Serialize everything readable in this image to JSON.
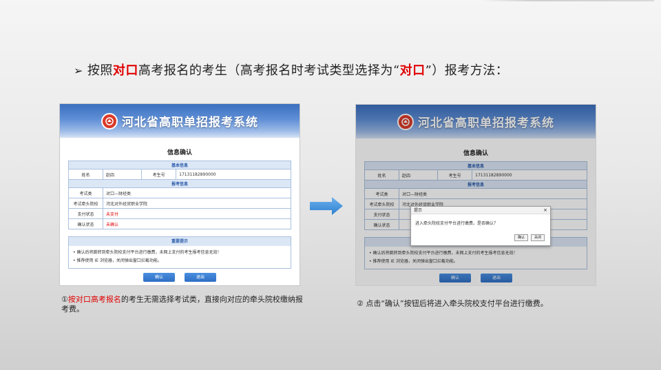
{
  "heading": {
    "bullet": "➢",
    "prefix": "按照",
    "highlight": "对口",
    "middle": "高考报名的考生（高考报名时考试类型选择为“",
    "highlight2": "对口",
    "suffix": "”）报考方法："
  },
  "system_title": "河北省高职单招报考系统",
  "left_panel": {
    "form_title": "信息确认",
    "basic_section": "基本信息",
    "name_label": "姓名",
    "name_value": "赵四",
    "exam_no_label": "考生号",
    "exam_no_value": "17131182890000",
    "apply_section": "报考信息",
    "exam_type_label": "考试类",
    "exam_type_value": "对口—财经类",
    "school_label": "考试牵头院校",
    "school_value": "河北对外经贸职业学院",
    "pay_label": "支付状态",
    "pay_value": "未支付",
    "confirm_label": "确认状态",
    "confirm_value": "未确认",
    "tips_title": "重要提示",
    "tip1": "确认后将跳转到牵头院校支付平台进行缴费，未网上支付的考生报考信息无效！",
    "tip2": "推荐使用 IE 浏览器，关闭弹出窗口拦截功能。",
    "confirm_button": "确认",
    "exit_button": "退出"
  },
  "right_panel": {
    "form_title": "信息确认",
    "basic_section": "基本信息",
    "name_label": "姓名",
    "name_value": "赵四",
    "exam_no_label": "考生号",
    "exam_no_value": "17131182890000",
    "apply_section": "报考信息",
    "exam_type_label": "考试类",
    "exam_type_value": "对口—财经类",
    "school_label": "考试牵头院校",
    "school_value": "河北对外经贸职业学院",
    "pay_label": "支付状态",
    "confirm_label": "确认状态",
    "tip1": "确认后将跳转到牵头院校支付平台进行缴费，未网上支付的考生报考信息无效！",
    "tip2": "推荐使用 IE 浏览器，关闭弹出窗口拦截功能。",
    "confirm_button": "确认",
    "exit_button": "退出",
    "dialog": {
      "title": "提示",
      "close": "×",
      "message": "进入牵头院校支付平台进行缴费，是否确认？",
      "ok": "确认",
      "cancel": "关闭"
    }
  },
  "caption_left": {
    "num": "①",
    "highlight": "按对口高考报名",
    "rest": "的考生无需选择考试类，直接向对应的牵头院校缴纳报考费。"
  },
  "caption_right": "② 点击“确认”按钮后将进入牵头院校支付平台进行缴费。",
  "colors": {
    "accent_red": "#e00000",
    "banner_blue": "#3b6fbf",
    "arrow_blue": "#3d8fd8"
  }
}
